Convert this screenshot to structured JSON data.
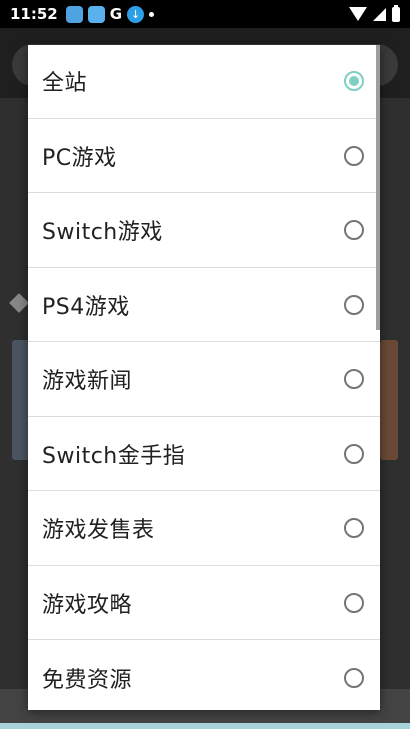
{
  "status_bar": {
    "time": "11:52",
    "icons": [
      "app-icon-a",
      "app-icon-b",
      "google-icon",
      "download-icon",
      "dot-icon",
      "wifi-icon",
      "signal-icon",
      "battery-icon"
    ],
    "g_label": "G"
  },
  "dialog": {
    "options": [
      {
        "label": "全站",
        "selected": true
      },
      {
        "label": "PC游戏",
        "selected": false
      },
      {
        "label": "Switch游戏",
        "selected": false
      },
      {
        "label": "PS4游戏",
        "selected": false
      },
      {
        "label": "游戏新闻",
        "selected": false
      },
      {
        "label": "Switch金手指",
        "selected": false
      },
      {
        "label": "游戏发售表",
        "selected": false
      },
      {
        "label": "游戏攻略",
        "selected": false
      },
      {
        "label": "免费资源",
        "selected": false
      }
    ]
  },
  "colors": {
    "radio_accent": "#7fcfc4",
    "radio_border": "#757575",
    "divider": "#dcdcdc"
  }
}
